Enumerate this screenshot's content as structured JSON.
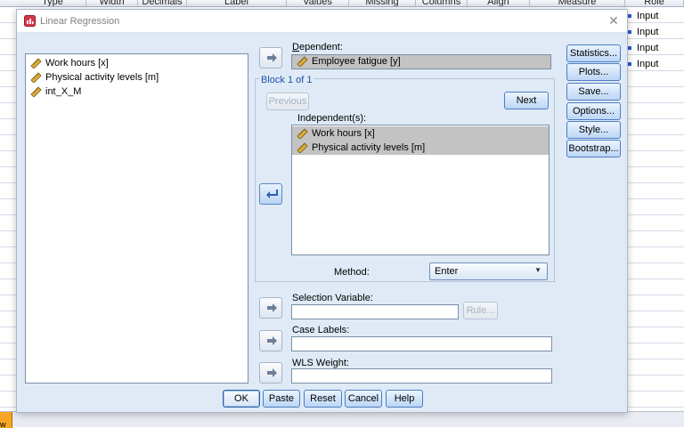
{
  "background": {
    "columns": [
      "Type",
      "Width",
      "Decimals",
      "Label",
      "Values",
      "Missing",
      "Columns",
      "Align",
      "Measure",
      "Role"
    ],
    "role_cells": [
      "Input",
      "Input",
      "Input",
      "Input"
    ],
    "bottom_tab": "w"
  },
  "dialog": {
    "title": "Linear Regression",
    "source_list": [
      "Work hours [x]",
      "Physical activity levels [m]",
      "int_X_M"
    ],
    "dependent": {
      "label": "Dependent:",
      "value": "Employee fatigue [y]"
    },
    "block": {
      "label": "Block 1 of 1",
      "previous": "Previous",
      "next": "Next"
    },
    "independent": {
      "label": "Independent(s):",
      "items": [
        "Work hours [x]",
        "Physical activity levels [m]"
      ]
    },
    "method": {
      "label": "Method:",
      "value": "Enter"
    },
    "selection_variable": {
      "label": "Selection Variable:",
      "rule_button": "Rule..."
    },
    "case_labels": {
      "label": "Case Labels:"
    },
    "wls_weight": {
      "label": "WLS Weight:"
    },
    "side_buttons": [
      "Statistics...",
      "Plots...",
      "Save...",
      "Options...",
      "Style...",
      "Bootstrap..."
    ],
    "bottom_buttons": [
      "OK",
      "Paste",
      "Reset",
      "Cancel",
      "Help"
    ]
  },
  "colors": {
    "dialog_bg": "#dfeaf6",
    "accent_blue": "#4d7dc2",
    "selected_item": "#c3c3c3"
  }
}
